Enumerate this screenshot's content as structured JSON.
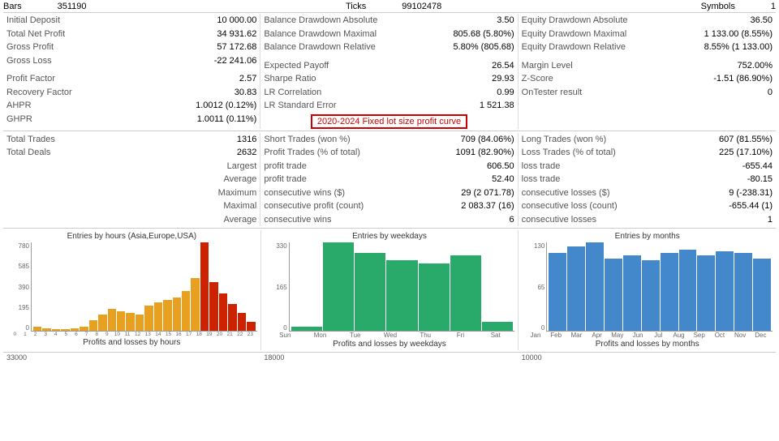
{
  "header": {
    "bars_label": "Bars",
    "bars_value": "351190",
    "ticks_label": "Ticks",
    "ticks_value": "99102478",
    "symbols_label": "Symbols",
    "symbols_value": "1"
  },
  "col1": [
    {
      "label": "Initial Deposit",
      "value": "10 000.00"
    },
    {
      "label": "Total Net Profit",
      "value": "34 931.62"
    },
    {
      "label": "Gross Profit",
      "value": "57 172.68"
    },
    {
      "label": "Gross Loss",
      "value": "-22 241.06"
    },
    {
      "label": "",
      "value": ""
    },
    {
      "label": "Profit Factor",
      "value": "2.57"
    },
    {
      "label": "Recovery Factor",
      "value": "30.83"
    },
    {
      "label": "AHPR",
      "value": "1.0012 (0.12%)"
    },
    {
      "label": "GHPR",
      "value": "1.0011 (0.11%)"
    }
  ],
  "col2": [
    {
      "label": "Balance Drawdown Absolute",
      "value": "3.50"
    },
    {
      "label": "Balance Drawdown Maximal",
      "value": "805.68 (5.80%)"
    },
    {
      "label": "Balance Drawdown Relative",
      "value": "5.80% (805.68)"
    },
    {
      "label": "",
      "value": ""
    },
    {
      "label": "Expected Payoff",
      "value": "26.54"
    },
    {
      "label": "Sharpe Ratio",
      "value": "29.93"
    },
    {
      "label": "LR Correlation",
      "value": "0.99"
    },
    {
      "label": "LR Standard Error",
      "value": "1 521.38"
    }
  ],
  "col3": [
    {
      "label": "Equity Drawdown Absolute",
      "value": "36.50"
    },
    {
      "label": "Equity Drawdown Maximal",
      "value": "1 133.00 (8.55%)"
    },
    {
      "label": "Equity Drawdown Relative",
      "value": "8.55% (1 133.00)"
    },
    {
      "label": "",
      "value": ""
    },
    {
      "label": "Margin Level",
      "value": "752.00%"
    },
    {
      "label": "Z-Score",
      "value": "-1.51 (86.90%)"
    },
    {
      "label": "OnTester result",
      "value": "0"
    }
  ],
  "highlight_text": "2020-2024 Fixed lot size profit curve",
  "trades": {
    "col1": [
      {
        "label": "Total Trades",
        "value": "1316"
      },
      {
        "label": "Total Deals",
        "value": "2632"
      },
      {
        "label": "Largest",
        "value": ""
      },
      {
        "label": "Average",
        "value": ""
      },
      {
        "label": "Maximum",
        "value": ""
      },
      {
        "label": "Maximal",
        "value": ""
      },
      {
        "label": "Average",
        "value": ""
      }
    ],
    "col2": [
      {
        "label": "Short Trades (won %)",
        "value": "709 (84.06%)"
      },
      {
        "label": "Profit Trades (% of total)",
        "value": "1091 (82.90%)"
      },
      {
        "label": "profit trade",
        "value": "606.50"
      },
      {
        "label": "profit trade",
        "value": "52.40"
      },
      {
        "label": "consecutive wins ($)",
        "value": "29 (2 071.78)"
      },
      {
        "label": "consecutive profit (count)",
        "value": "2 083.37 (16)"
      },
      {
        "label": "consecutive wins",
        "value": "6"
      }
    ],
    "col3": [
      {
        "label": "Long Trades (won %)",
        "value": "607 (81.55%)"
      },
      {
        "label": "Loss Trades (% of total)",
        "value": "225 (17.10%)"
      },
      {
        "label": "loss trade",
        "value": "-655.44"
      },
      {
        "label": "loss trade",
        "value": "-80.15"
      },
      {
        "label": "consecutive losses ($)",
        "value": "9 (-238.31)"
      },
      {
        "label": "consecutive loss (count)",
        "value": "-655.44 (1)"
      },
      {
        "label": "consecutive losses",
        "value": "1"
      }
    ]
  },
  "charts": {
    "hours": {
      "title": "Entries by hours (Asia,Europe,USA)",
      "y_labels": [
        "780",
        "585",
        "390",
        "195",
        "0"
      ],
      "x_labels": [
        "0",
        "1",
        "2",
        "3",
        "4",
        "5",
        "6",
        "7",
        "8",
        "9",
        "10",
        "11",
        "12",
        "13",
        "14",
        "15",
        "16",
        "17",
        "18",
        "19",
        "20",
        "21",
        "22",
        "23"
      ],
      "bottom_label": "Profits and losses by hours",
      "bars": [
        5,
        3,
        2,
        2,
        3,
        5,
        12,
        18,
        25,
        22,
        20,
        18,
        28,
        32,
        35,
        38,
        45,
        60,
        100,
        55,
        42,
        30,
        20,
        10
      ],
      "colors": [
        "#e8a020",
        "#e8a020",
        "#e8a020",
        "#e8a020",
        "#e8a020",
        "#e8a020",
        "#e8a020",
        "#e8a020",
        "#e8a020",
        "#e8a020",
        "#e8a020",
        "#e8a020",
        "#e8a020",
        "#e8a020",
        "#e8a020",
        "#e8a020",
        "#e8a020",
        "#e8a020",
        "#cc2200",
        "#cc2200",
        "#cc2200",
        "#cc2200",
        "#cc2200",
        "#cc2200"
      ]
    },
    "weekdays": {
      "title": "Entries by weekdays",
      "y_labels": [
        "330",
        "165",
        "0"
      ],
      "x_labels": [
        "Sun",
        "Mon",
        "Tue",
        "Wed",
        "Thu",
        "Fri",
        "Sat"
      ],
      "bottom_label": "Profits and losses by weekdays",
      "bars": [
        5,
        100,
        88,
        80,
        76,
        85,
        10
      ],
      "colors": [
        "#2aaa6a",
        "#2aaa6a",
        "#2aaa6a",
        "#2aaa6a",
        "#2aaa6a",
        "#2aaa6a",
        "#2aaa6a"
      ]
    },
    "months": {
      "title": "Entries by months",
      "y_labels": [
        "130",
        "65",
        "0"
      ],
      "x_labels": [
        "Jan",
        "Feb",
        "Mar",
        "Apr",
        "May",
        "Jun",
        "Jul",
        "Aug",
        "Sep",
        "Oct",
        "Nov",
        "Dec"
      ],
      "bottom_label": "Profits and losses by months",
      "bars": [
        88,
        95,
        100,
        82,
        85,
        80,
        88,
        92,
        85,
        90,
        88,
        82
      ],
      "colors": [
        "#4488cc",
        "#4488cc",
        "#4488cc",
        "#4488cc",
        "#4488cc",
        "#4488cc",
        "#4488cc",
        "#4488cc",
        "#4488cc",
        "#4488cc",
        "#4488cc",
        "#4488cc"
      ]
    }
  },
  "bottom_labels": {
    "hours_pl": "Profits and losses by hours",
    "weekdays_pl": "Profits and losses by weekdays",
    "months_pl": "Profits and losses by months"
  }
}
